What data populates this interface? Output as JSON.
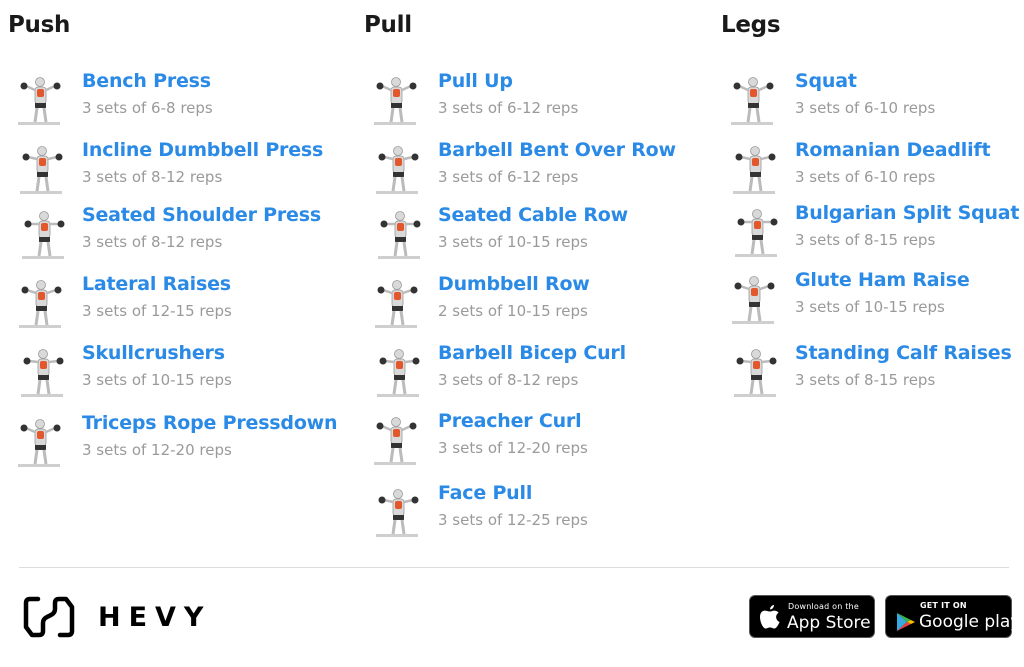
{
  "columns": {
    "push": {
      "title": "Push",
      "exercises": [
        {
          "name": "Bench Press",
          "sets": "3 sets of 6-8 reps",
          "icon": "bench-press-illustration"
        },
        {
          "name": "Incline Dumbbell Press",
          "sets": "3 sets of 8-12 reps",
          "icon": "incline-dumbbell-press-illustration"
        },
        {
          "name": "Seated Shoulder Press",
          "sets": "3 sets of 8-12 reps",
          "icon": "seated-shoulder-press-illustration"
        },
        {
          "name": "Lateral Raises",
          "sets": "3 sets of 12-15 reps",
          "icon": "lateral-raises-illustration"
        },
        {
          "name": "Skullcrushers",
          "sets": "3 sets of 10-15 reps",
          "icon": "skullcrushers-illustration"
        },
        {
          "name": "Triceps Rope Pressdown",
          "sets": "3 sets of 12-20 reps",
          "icon": "triceps-rope-pressdown-illustration"
        }
      ]
    },
    "pull": {
      "title": "Pull",
      "exercises": [
        {
          "name": "Pull Up",
          "sets": "3 sets of 6-12 reps",
          "icon": "pull-up-illustration"
        },
        {
          "name": "Barbell Bent Over Row",
          "sets": "3 sets of 6-12 reps",
          "icon": "barbell-row-illustration"
        },
        {
          "name": "Seated Cable Row",
          "sets": "3 sets of 10-15 reps",
          "icon": "seated-cable-row-illustration"
        },
        {
          "name": "Dumbbell Row",
          "sets": "2 sets of 10-15 reps",
          "icon": "dumbbell-row-illustration"
        },
        {
          "name": "Barbell Bicep Curl",
          "sets": "3 sets of 8-12 reps",
          "icon": "bicep-curl-illustration"
        },
        {
          "name": "Preacher Curl",
          "sets": "3 sets of 12-20 reps",
          "icon": "preacher-curl-illustration"
        },
        {
          "name": "Face Pull",
          "sets": "3 sets of 12-25 reps",
          "icon": "face-pull-illustration"
        }
      ]
    },
    "legs": {
      "title": "Legs",
      "exercises": [
        {
          "name": "Squat",
          "sets": "3 sets of 6-10 reps",
          "icon": "squat-illustration"
        },
        {
          "name": "Romanian Deadlift",
          "sets": "3 sets of 6-10 reps",
          "icon": "romanian-deadlift-illustration"
        },
        {
          "name": "Bulgarian Split Squat",
          "sets": "3 sets of 8-15 reps",
          "icon": "bulgarian-split-squat-illustration"
        },
        {
          "name": "Glute Ham Raise",
          "sets": "3 sets of 10-15 reps",
          "icon": "glute-ham-raise-illustration"
        },
        {
          "name": "Standing Calf Raises",
          "sets": "3 sets of 8-15 reps",
          "icon": "standing-calf-raises-illustration"
        }
      ]
    }
  },
  "footer": {
    "brand": "HEVY",
    "app_store": {
      "small": "Download on the",
      "big": "App Store"
    },
    "google_play": {
      "small": "GET IT ON",
      "big": "Google play"
    }
  },
  "colors": {
    "accent": "#2a8ae6",
    "muscle_highlight": "#e2572b",
    "subtext": "#9a9a9a",
    "heading": "#1a1a1a"
  }
}
